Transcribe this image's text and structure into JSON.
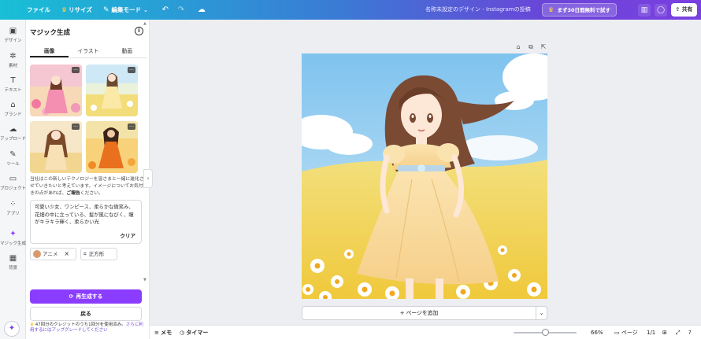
{
  "topbar": {
    "file_label": "ファイル",
    "resize_label": "リサイズ",
    "edit_mode_label": "編集モード",
    "doc_title": "名称未設定のデザイン - Instagramの投稿",
    "trial_label": "まず30日間無料で試す",
    "share_label": "共有"
  },
  "rail": {
    "items": [
      {
        "label": "デザイン",
        "icon": "layout-icon"
      },
      {
        "label": "素材",
        "icon": "elements-icon"
      },
      {
        "label": "テキスト",
        "icon": "text-icon"
      },
      {
        "label": "ブランド",
        "icon": "brand-icon"
      },
      {
        "label": "アップロード",
        "icon": "upload-icon"
      },
      {
        "label": "ツール",
        "icon": "draw-icon"
      },
      {
        "label": "プロジェクト",
        "icon": "folder-icon"
      },
      {
        "label": "アプリ",
        "icon": "apps-icon"
      },
      {
        "label": "マジック生成",
        "icon": "magic-icon"
      },
      {
        "label": "背景",
        "icon": "background-icon"
      }
    ]
  },
  "panel": {
    "title": "マジック生成",
    "tabs": [
      "画像",
      "イラスト",
      "動画"
    ],
    "notice_text": "当社はこの新しいテクノロジーを皆さまと一緒に進化させていきたいと考えています。イメージについてお気付きの点があれば、",
    "notice_link": "ご報告",
    "notice_tail": "ください。",
    "prompt_text": "可愛い少女、ワンピース、柔らかな微笑み、花畑の中に立っている、髪が風になびく、瞳がキラキラ輝く、柔らかい光",
    "clear_label": "クリア",
    "style_chip_label": "アニメ",
    "ratio_chip_label": "正方形",
    "regen_label": "再生成する",
    "back_label": "戻る",
    "credit_text": "47回分のクレジットのうち1回分を使用済み。",
    "credit_link": "さらに利用するにはアップグレードしてください"
  },
  "canvas": {
    "add_page_label": "+ ページを追加"
  },
  "bottombar": {
    "notes_label": "メモ",
    "timer_label": "タイマー",
    "zoom_value": "66%",
    "pages_label": "ページ",
    "page_count": "1/1"
  },
  "colors": {
    "accent": "#8b3dff",
    "topbar_start": "#18bfd6",
    "topbar_end": "#7b3fe0"
  }
}
